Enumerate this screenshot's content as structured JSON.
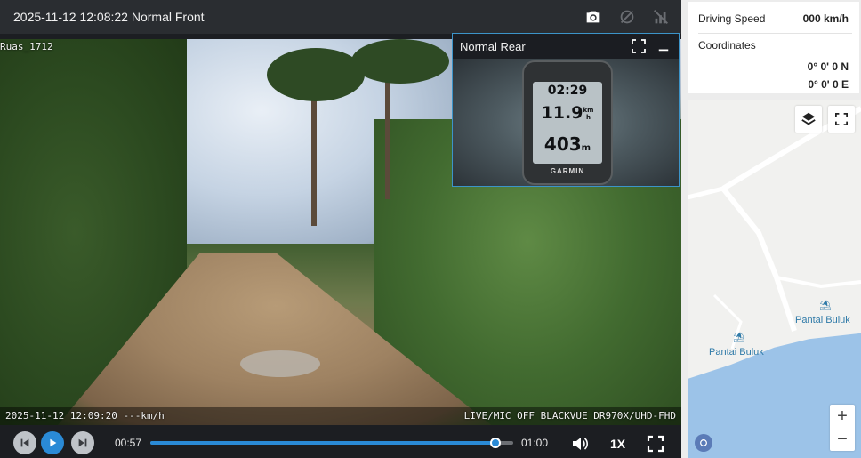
{
  "player": {
    "title": "2025-11-12 12:08:22 Normal Front",
    "camera_label": "Ruas_1712",
    "osd_left": "2025-11-12 12:09:20 ---km/h",
    "osd_right": "LIVE/MIC OFF BLACKVUE DR970X/UHD-FHD",
    "toolbar_icons": [
      "camera-icon",
      "satellite-off-icon",
      "signal-off-icon"
    ]
  },
  "rear": {
    "title": "Normal Rear",
    "gps_device": {
      "time": "02:29",
      "speed": "11.9",
      "speed_unit_top": "km",
      "speed_unit_bottom": "h",
      "distance": "403",
      "distance_unit": "m",
      "brand": "GARMIN"
    }
  },
  "controls": {
    "current_time": "00:57",
    "total_time": "01:00",
    "progress": 0.95,
    "playback_speed": "1X"
  },
  "info": {
    "speed_label": "Driving Speed",
    "speed_value": "000 km/h",
    "coords_label": "Coordinates",
    "lat": "0° 0'  0 N",
    "lon": "0° 0'  0 E"
  },
  "map": {
    "poi_1": "Pantai Buluk",
    "poi_2": "Pantai Buluk",
    "zoom_in": "+",
    "zoom_out": "−"
  },
  "colors": {
    "accent": "#2a8ad6",
    "topbar": "#2a2d31",
    "pip_border": "#3c94c9"
  }
}
